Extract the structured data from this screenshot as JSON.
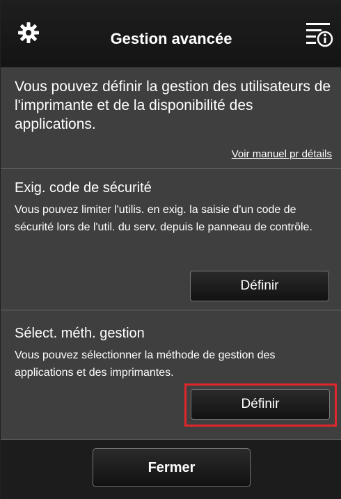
{
  "header": {
    "title": "Gestion avancée",
    "left_icon": "gear-icon",
    "right_icon": "menu-info-icon"
  },
  "intro": {
    "text": "Vous pouvez définir la gestion des utilisateurs de l'imprimante et de la disponibilité des applications.",
    "link_label": "Voir manuel pr détails"
  },
  "security": {
    "title": "Exig. code de sécurité",
    "description": "Vous pouvez limiter l'utilis. en exig. la saisie d'un code de sécurité lors de l'util. du serv. depuis le panneau de contrôle.",
    "button_label": "Définir"
  },
  "management": {
    "title": "Sélect. méth. gestion",
    "description": "Vous pouvez sélectionner la méthode de gestion des applications et des imprimantes.",
    "button_label": "Définir"
  },
  "footer": {
    "close_label": "Fermer"
  },
  "colors": {
    "highlight": "#e0262b",
    "header_bg": "#141414",
    "content_bg": "#3f3f3f"
  }
}
